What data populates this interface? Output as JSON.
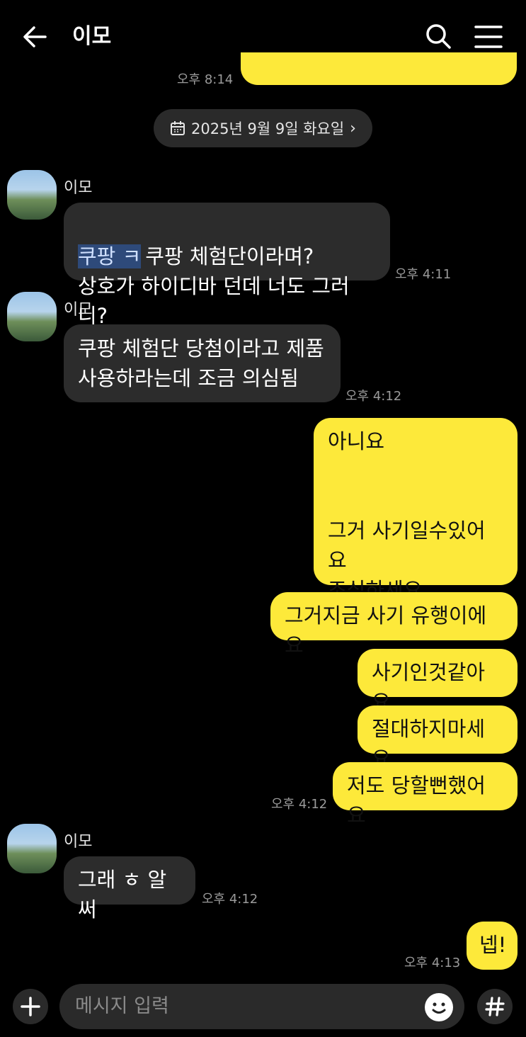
{
  "header": {
    "title": "이모"
  },
  "top_partial": {
    "time": "오후 8:14"
  },
  "date_divider": {
    "label": "2025년 9월 9일 화요일"
  },
  "messages": [
    {
      "sender": "이모",
      "prefix": "쿠팡 ㅋ",
      "text": "쿠팡 체험단이라며?\n상호가 하이디바 던데 너도 그러니?",
      "time": "오후 4:11"
    },
    {
      "sender": "이모",
      "text": "쿠팡 체험단 당첨이라고 제품\n사용하라는데 조금 의심됨",
      "time": "오후 4:12"
    },
    {
      "text": "아니요\n\n\n그거 사기일수있어요\n조심하세요"
    },
    {
      "text": "그거지금 사기 유행이에요"
    },
    {
      "text": "사기인것같아요"
    },
    {
      "text": "절대하지마세요"
    },
    {
      "text": "저도 당할뻔했어요",
      "time": "오후 4:12"
    },
    {
      "sender": "이모",
      "text": "그래 ㅎ 알써",
      "time": "오후 4:12"
    },
    {
      "text": "넵!",
      "time": "오후 4:13"
    }
  ],
  "composer": {
    "placeholder": "메시지 입력"
  },
  "colors": {
    "outgoing": "#fde93a",
    "incoming": "#2c2c2c",
    "background": "#000000"
  }
}
